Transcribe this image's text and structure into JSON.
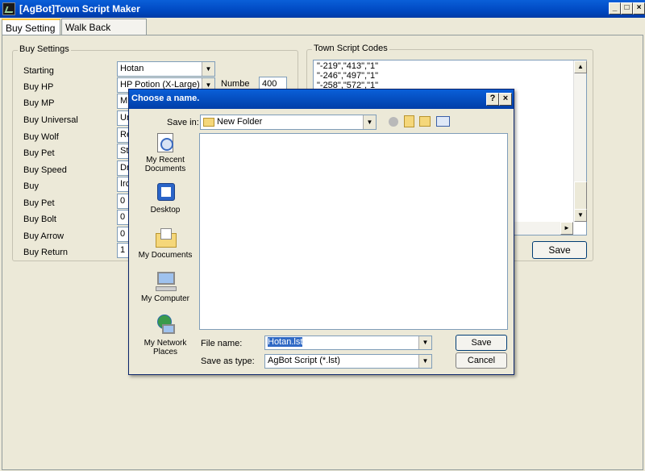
{
  "window": {
    "title": "[AgBot]Town Script Maker"
  },
  "tabs": [
    {
      "label": "Buy Setting"
    },
    {
      "label": "Walk Back Setting"
    }
  ],
  "buy_settings": {
    "legend": "Buy Settings",
    "rows": [
      {
        "label": "Starting",
        "value": "Hotan",
        "combo": true
      },
      {
        "label": "Buy HP",
        "value": "HP Potion (X-Large)",
        "combo": true
      },
      {
        "label": "Buy MP",
        "value": "MI"
      },
      {
        "label": "Buy Universal",
        "value": "Ur"
      },
      {
        "label": "Buy Wolf",
        "value": "Re"
      },
      {
        "label": "Buy Pet",
        "value": "St"
      },
      {
        "label": "Buy Speed",
        "value": "Dr"
      },
      {
        "label": "Buy",
        "value": "Irc"
      },
      {
        "label": "Buy Pet",
        "value": "0"
      },
      {
        "label": "Buy Bolt",
        "value": "0"
      },
      {
        "label": "Buy Arrow",
        "value": "0"
      },
      {
        "label": "Buy Return",
        "value": "1"
      }
    ],
    "number_label": "Numbe",
    "number_value": "400"
  },
  "codes": {
    "legend": "Town Script Codes",
    "lines": [
      "\"-219\",\"413\",\"1\"",
      "\"-246\",\"497\",\"1\"",
      "\"-258\",\"572\",\"1\""
    ],
    "save_label": "Save"
  },
  "dialog": {
    "title": "Choose a name.",
    "save_in_label": "Save in:",
    "save_in_value": "New Folder",
    "places": [
      {
        "label": "My Recent Documents",
        "icon": "recent-documents-icon"
      },
      {
        "label": "Desktop",
        "icon": "desktop-icon"
      },
      {
        "label": "My Documents",
        "icon": "my-documents-icon"
      },
      {
        "label": "My Computer",
        "icon": "my-computer-icon"
      },
      {
        "label": "My Network Places",
        "icon": "network-places-icon"
      }
    ],
    "file_name_label": "File name:",
    "file_name_value": "Hotan.lst",
    "save_type_label": "Save as type:",
    "save_type_value": "AgBot Script (*.lst)",
    "save_button": "Save",
    "cancel_button": "Cancel"
  }
}
